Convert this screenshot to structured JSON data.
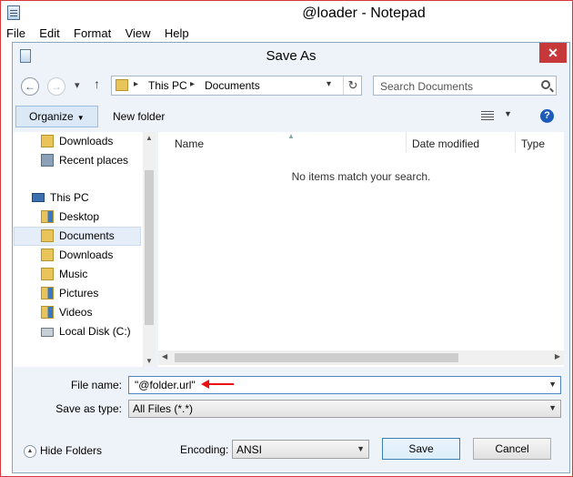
{
  "notepad": {
    "title": "@loader - Notepad",
    "menu": [
      "File",
      "Edit",
      "Format",
      "View",
      "Help"
    ]
  },
  "dialog": {
    "title": "Save As",
    "close_label": "✕",
    "address": {
      "crumbs": [
        "This PC",
        "Documents"
      ]
    },
    "search_placeholder": "Search Documents",
    "toolbar": {
      "organize_label": "Organize",
      "new_folder_label": "New folder",
      "help_label": "?"
    },
    "nav_items": [
      {
        "label": "Downloads",
        "icon": "downloads-folder-icon"
      },
      {
        "label": "Recent places",
        "icon": "recent-places-icon"
      },
      {
        "label": "This PC",
        "icon": "pc-icon"
      },
      {
        "label": "Desktop",
        "icon": "desktop-folder-icon"
      },
      {
        "label": "Documents",
        "icon": "documents-folder-icon",
        "selected": true
      },
      {
        "label": "Downloads",
        "icon": "downloads-folder-icon"
      },
      {
        "label": "Music",
        "icon": "music-folder-icon"
      },
      {
        "label": "Pictures",
        "icon": "pictures-folder-icon"
      },
      {
        "label": "Videos",
        "icon": "videos-folder-icon"
      },
      {
        "label": "Local Disk (C:)",
        "icon": "disk-icon"
      }
    ],
    "columns": [
      "Name",
      "Date modified",
      "Type"
    ],
    "empty_message": "No items match your search.",
    "file_name_label": "File name:",
    "file_name_value": "\"@folder.url\"",
    "save_as_type_label": "Save as type:",
    "save_as_type_value": "All Files  (*.*)",
    "hide_folders_label": "Hide Folders",
    "encoding_label": "Encoding:",
    "encoding_value": "ANSI",
    "save_label": "Save",
    "cancel_label": "Cancel"
  }
}
